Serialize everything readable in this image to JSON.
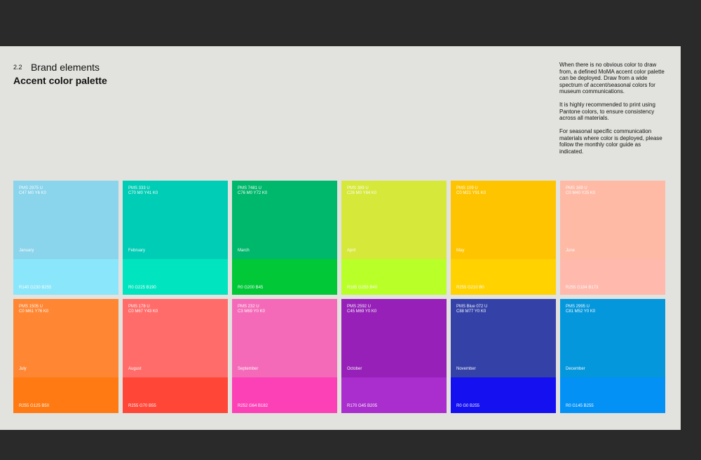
{
  "header": {
    "section_number": "2.2",
    "section_name": "Brand elements",
    "title": "Accent color palette"
  },
  "intro": {
    "p1": "When there is no obvious color to draw from, a defined MoMA accent color palette can be deployed. Draw from a wide spectrum of accent/seasonal colors for museum communications.",
    "p2": "It is highly recommended to print using Pantone colors, to ensure consistency across all materials.",
    "p3": "For seasonal specific communication materials where color is deployed, please follow the monthly color guide as indicated."
  },
  "swatches": [
    {
      "pms": "PMS 2975 U",
      "cmyk": "C47 M0 Y6 K0",
      "month": "January",
      "rgb": "R140 G230 B255",
      "top_color": "#8ad4ec",
      "bottom_color": "#8ae6fb"
    },
    {
      "pms": "PMS 333 U",
      "cmyk": "C70 M0 Y41 K0",
      "month": "February",
      "rgb": "R0 G225 B190",
      "top_color": "#00cdb5",
      "bottom_color": "#00e5bf"
    },
    {
      "pms": "PMS 7481 U",
      "cmyk": "C76 M0 Y72 K0",
      "month": "March",
      "rgb": "R0 G200 B45",
      "top_color": "#00b86c",
      "bottom_color": "#00c837"
    },
    {
      "pms": "PMS 389 U",
      "cmyk": "C26 M0 Y84 K0",
      "month": "April",
      "rgb": "R185 G255 B40",
      "top_color": "#d6e83a",
      "bottom_color": "#b9ff28"
    },
    {
      "pms": "PMS 109 U",
      "cmyk": "C0 M21 Y91 K0",
      "month": "May",
      "rgb": "R255 G210 B0",
      "top_color": "#ffc400",
      "bottom_color": "#ffd200"
    },
    {
      "pms": "PMS 169 U",
      "cmyk": "C0 M40 Y25 K0",
      "month": "June",
      "rgb": "R255 G184 B173",
      "top_color": "#ffbaa6",
      "bottom_color": "#ffb9ad"
    },
    {
      "pms": "PMS 1505 U",
      "cmyk": "C0 M61 Y76 K0",
      "month": "July",
      "rgb": "R255 G125 B50",
      "top_color": "#ff8633",
      "bottom_color": "#ff7a12"
    },
    {
      "pms": "PMS 178 U",
      "cmyk": "C0 M67 Y43 K0",
      "month": "August",
      "rgb": "R255 G70 B55",
      "top_color": "#ff6c6a",
      "bottom_color": "#ff4637"
    },
    {
      "pms": "PMS 232 U",
      "cmyk": "C3 M69 Y0 K0",
      "month": "September",
      "rgb": "R252 G64 B182",
      "top_color": "#f46ab8",
      "bottom_color": "#fc40b6"
    },
    {
      "pms": "PMS 2592 U",
      "cmyk": "C45 M69 Y0 K0",
      "month": "October",
      "rgb": "R170 G45 B205",
      "top_color": "#9620b8",
      "bottom_color": "#aa2dcd"
    },
    {
      "pms": "PMS Blue 072 U",
      "cmyk": "C88 M77 Y0 K0",
      "month": "November",
      "rgb": "R0 G0 B255",
      "top_color": "#3442a8",
      "bottom_color": "#1410f0"
    },
    {
      "pms": "PMS 2995 U",
      "cmyk": "C81 M52 Y0 K0",
      "month": "December",
      "rgb": "R0 G145 B255",
      "top_color": "#0497dc",
      "bottom_color": "#0491f6"
    }
  ]
}
